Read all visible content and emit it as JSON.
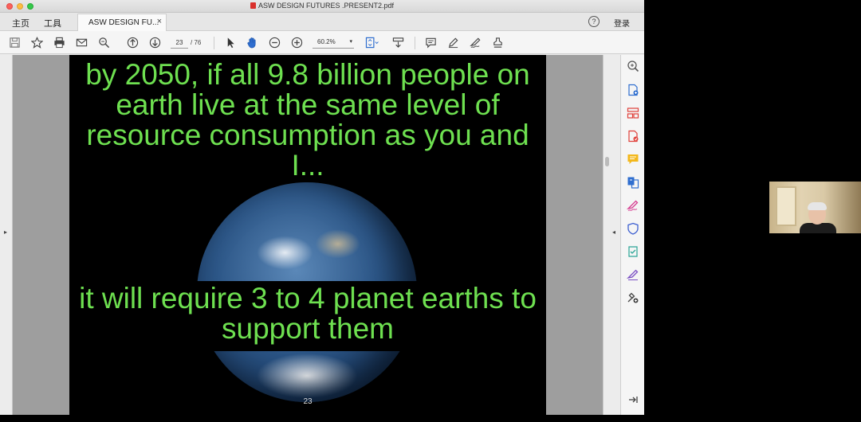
{
  "window": {
    "title": "ASW DESIGN FUTURES .PRESENT2.pdf"
  },
  "tabbar": {
    "home_label": "主页",
    "tools_label": "工具",
    "doc_tab_label": "ASW DESIGN FU...",
    "doc_tab_close": "×",
    "help_label": "?",
    "signin_label": "登录"
  },
  "toolbar": {
    "page_current": "23",
    "page_total": "/ 76",
    "zoom": "60.2%",
    "zoom_caret": "▾"
  },
  "slide": {
    "text_top": "by 2050, if all 9.8 billion people on earth live at the same level of resource consumption as you and I...",
    "text_bottom": "it will require 3 to 4 planet earths to support them",
    "page_number": "23",
    "text_color": "#6ee050"
  },
  "icons": {
    "toolbar": [
      "save-icon",
      "bookmark-star-icon",
      "print-icon",
      "email-icon",
      "search-zoom-icon",
      "previous-page-icon",
      "next-page-icon",
      "select-arrow-icon",
      "hand-tool-icon",
      "zoom-out-icon",
      "zoom-in-icon",
      "fit-page-icon",
      "scroll-mode-icon",
      "comment-icon",
      "highlight-pen-icon",
      "sign-icon",
      "stamp-icon"
    ],
    "tool_pane": [
      "enhance-scan-icon",
      "create-pdf-icon",
      "organize-pages-icon",
      "export-pdf-icon",
      "comment-icon",
      "combine-files-icon",
      "fill-sign-icon",
      "protect-icon",
      "optimize-icon",
      "send-for-signature-icon",
      "more-tools-icon",
      "collapse-pane-icon"
    ]
  }
}
